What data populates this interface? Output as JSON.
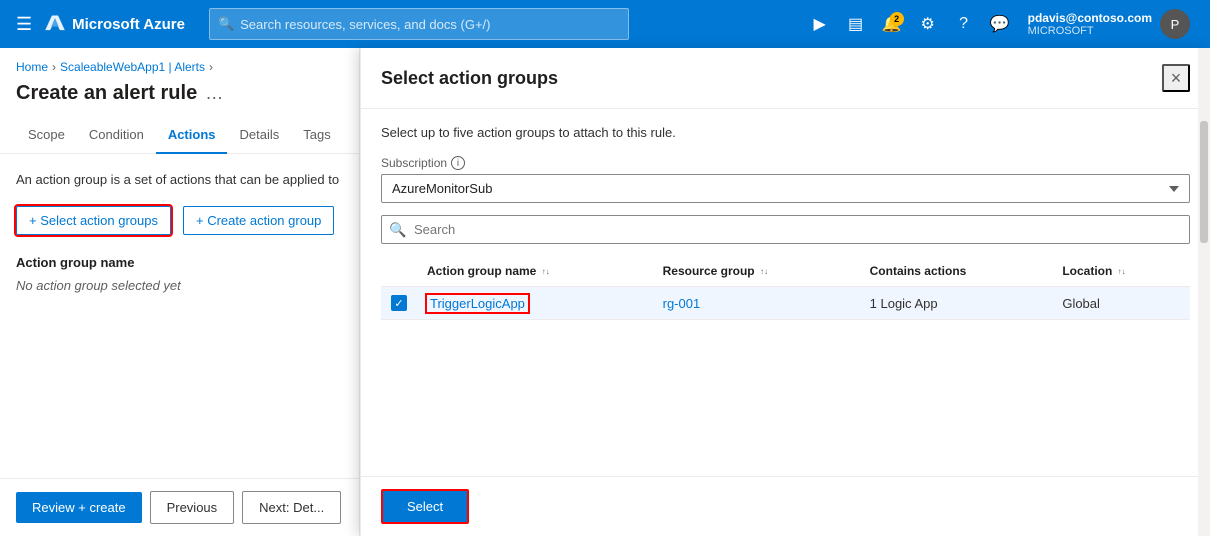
{
  "topnav": {
    "logo_text": "Microsoft Azure",
    "search_placeholder": "Search resources, services, and docs (G+/)",
    "notifications_count": "2",
    "user_email": "pdavis@contoso.com",
    "user_tenant": "MICROSOFT"
  },
  "breadcrumb": {
    "home": "Home",
    "resource": "ScaleableWebApp1 | Alerts"
  },
  "page": {
    "title": "Create an alert rule",
    "more_icon": "…"
  },
  "tabs": [
    {
      "id": "scope",
      "label": "Scope"
    },
    {
      "id": "condition",
      "label": "Condition"
    },
    {
      "id": "actions",
      "label": "Actions",
      "active": true
    },
    {
      "id": "details",
      "label": "Details"
    },
    {
      "id": "tags",
      "label": "Tags"
    }
  ],
  "actions_tab": {
    "info_text": "An action group is a set of actions that can be applied to",
    "select_btn": "+ Select action groups",
    "create_btn": "+ Create action group",
    "section_label": "Action group name",
    "no_selection_text": "No action group selected yet"
  },
  "bottom_bar": {
    "review_create": "Review + create",
    "previous": "Previous",
    "next": "Next: Det..."
  },
  "dialog": {
    "title": "Select action groups",
    "subtitle": "Select up to five action groups to attach to this rule.",
    "subscription_label": "Subscription",
    "subscription_info": "i",
    "subscription_value": "AzureMonitorSub",
    "search_placeholder": "Search",
    "table_headers": [
      {
        "id": "name",
        "label": "Action group name",
        "sortable": true
      },
      {
        "id": "resource_group",
        "label": "Resource group",
        "sortable": true
      },
      {
        "id": "contains_actions",
        "label": "Contains actions",
        "sortable": false
      },
      {
        "id": "location",
        "label": "Location",
        "sortable": true
      }
    ],
    "rows": [
      {
        "checked": true,
        "name": "TriggerLogicApp",
        "resource_group": "rg-001",
        "contains_actions": "1 Logic App",
        "location": "Global"
      }
    ],
    "select_btn": "Select",
    "close_icon": "×"
  }
}
